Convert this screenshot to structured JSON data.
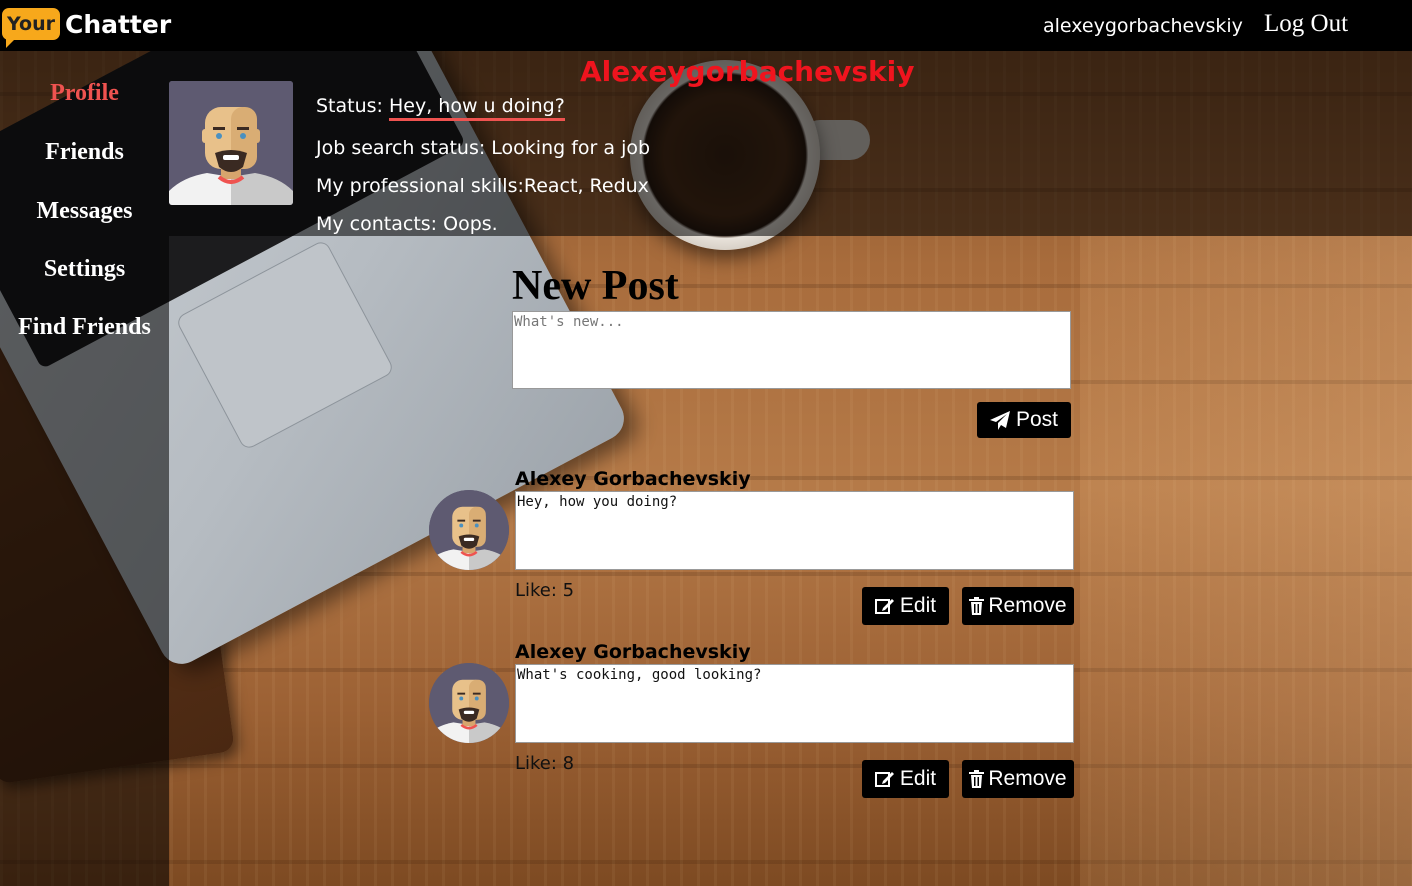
{
  "header": {
    "logo_badge": "Your",
    "logo_text": "Chatter",
    "username": "alexeygorbachevskiy",
    "logout_label": "Log Out"
  },
  "sidebar": {
    "items": [
      {
        "label": "Profile",
        "active": true
      },
      {
        "label": "Friends",
        "active": false
      },
      {
        "label": "Messages",
        "active": false
      },
      {
        "label": "Settings",
        "active": false
      },
      {
        "label": "Find Friends",
        "active": false
      }
    ]
  },
  "profile": {
    "name": "Alexeygorbachevskiy",
    "status_label": "Status:",
    "status_value": "Hey, how u doing?",
    "job_search": "Job search status: Looking for a job",
    "skills": "My professional skills:React, Redux",
    "contacts": "My contacts: Oops."
  },
  "new_post": {
    "title": "New Post",
    "placeholder": "What's new...",
    "button_label": "Post"
  },
  "posts": [
    {
      "author": "Alexey Gorbachevskiy",
      "text": "Hey, how you doing?",
      "likes": "Like: 5",
      "edit_label": "Edit",
      "remove_label": "Remove"
    },
    {
      "author": "Alexey Gorbachevskiy",
      "text": "What's cooking, good looking?",
      "likes": "Like: 8",
      "edit_label": "Edit",
      "remove_label": "Remove"
    }
  ],
  "colors": {
    "accent_red": "#ef5350",
    "name_red": "#f0141e",
    "logo_orange": "#f7a81b",
    "header_bg": "#000000"
  },
  "icons": {
    "post_button": "paper-plane-icon",
    "edit_button": "edit-icon",
    "remove_button": "trash-icon"
  }
}
